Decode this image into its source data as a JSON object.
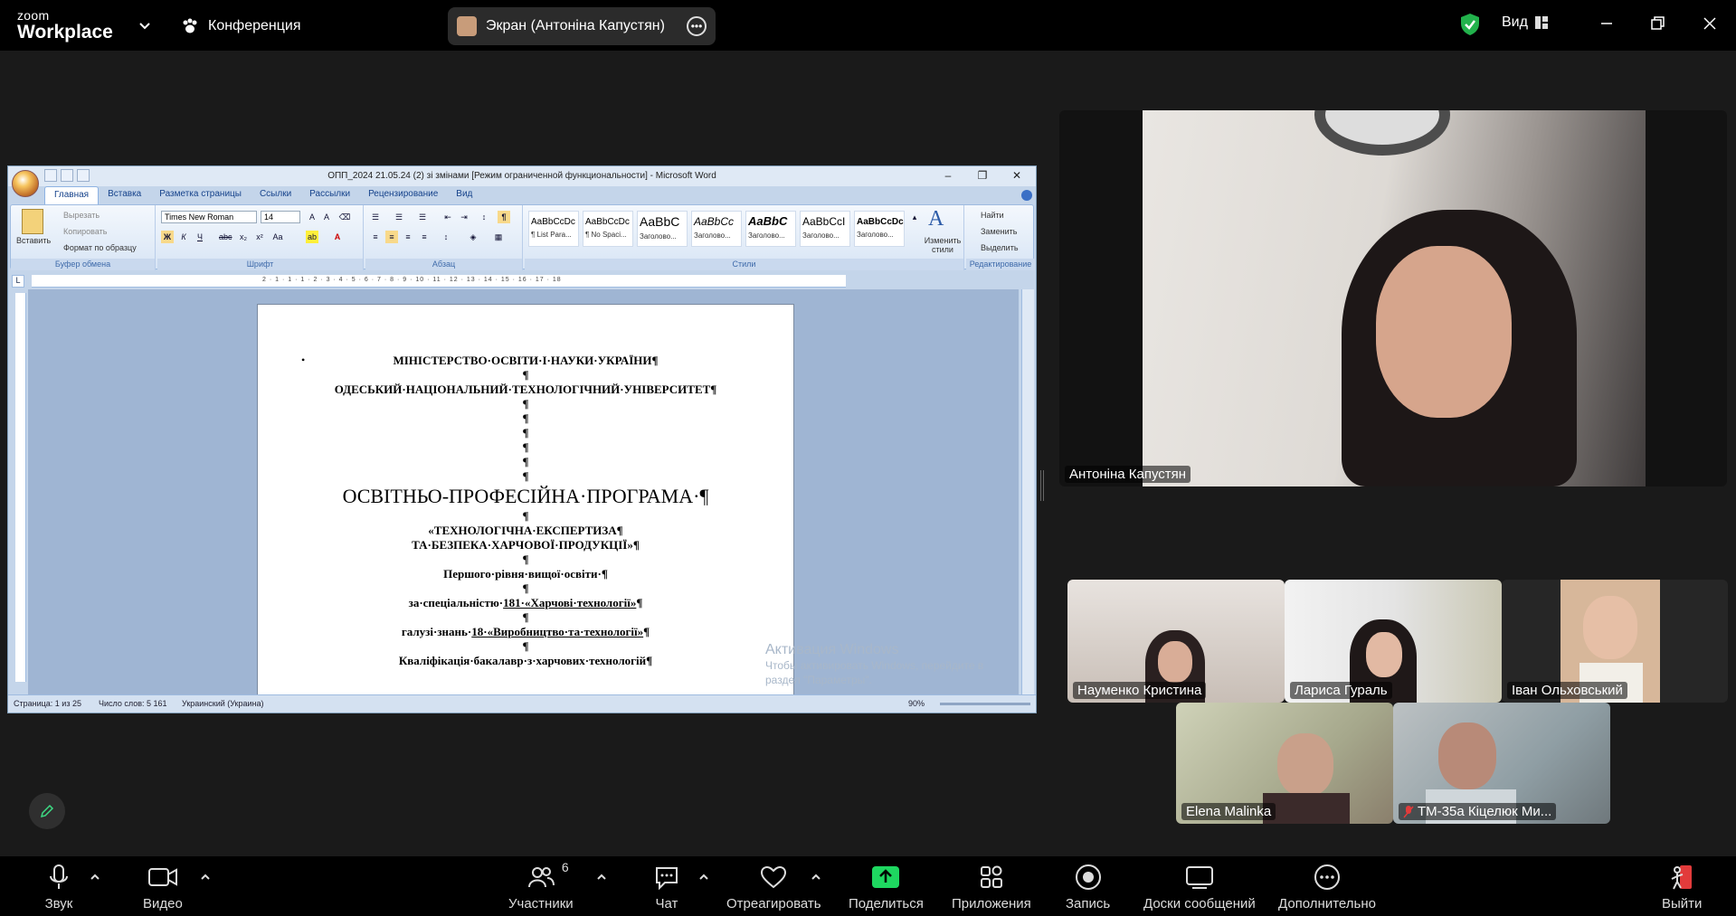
{
  "topbar": {
    "logo_line1": "zoom",
    "logo_line2": "Workplace",
    "conference_label": "Конференция",
    "share_label": "Экран (Антоніна Капустян)",
    "view_label": "Вид"
  },
  "word": {
    "title": "ОПП_2024 21.05.24 (2) зі змінами [Режим ограниченной функциональности] - Microsoft Word",
    "tabs": [
      "Главная",
      "Вставка",
      "Разметка страницы",
      "Ссылки",
      "Рассылки",
      "Рецензирование",
      "Вид"
    ],
    "clipboard": {
      "paste": "Вставить",
      "cut": "Вырезать",
      "copy": "Копировать",
      "format_painter": "Формат по образцу",
      "group": "Буфер обмена"
    },
    "font": {
      "name": "Times New Roman",
      "size": "14",
      "group": "Шрифт"
    },
    "paragraph_group": "Абзац",
    "styles": [
      {
        "sample": "AaBbCcDc",
        "name": "¶ List Para..."
      },
      {
        "sample": "AaBbCcDc",
        "name": "¶ No Spaci..."
      },
      {
        "sample": "AaBbC",
        "name": "Заголово..."
      },
      {
        "sample": "AaBbCc",
        "name": "Заголово..."
      },
      {
        "sample": "AaBbC",
        "name": "Заголово..."
      },
      {
        "sample": "AaBbCcI",
        "name": "Заголово..."
      },
      {
        "sample": "AaBbCcDc",
        "name": "Заголово..."
      }
    ],
    "change_styles": "Изменить стили",
    "styles_group": "Стили",
    "editing": {
      "find": "Найти",
      "replace": "Заменить",
      "select": "Выделить",
      "group": "Редактирование"
    },
    "doc_lines": {
      "l1": "МІНІСТЕРСТВО·ОСВІТИ·І·НАУКИ·УКРАЇНИ¶",
      "l2": "¶",
      "l3": "ОДЕСЬКИЙ·НАЦІОНАЛЬНИЙ·ТЕХНОЛОГІЧНИЙ·УНІВЕРСИТЕТ¶",
      "l4": "¶",
      "title": "ОСВІТНЬО-ПРОФЕСІЙНА·ПРОГРАМА·¶",
      "l5": "«ТЕХНОЛОГІЧНА·ЕКСПЕРТИЗА¶",
      "l6": "ТА·БЕЗПЕКА·ХАРЧОВОЇ·ПРОДУКЦІЇ»¶",
      "l7": "Першого·рівня·вищої·освіти·¶",
      "l8a": "за·спеціальністю·",
      "l8b": "181·«Харчові·технології»",
      "l8c": "¶",
      "l9a": "галузі·знань·",
      "l9b": "18·«Виробництво·та·технології»",
      "l9c": "¶",
      "l10": "Кваліфікація·бакалавр·з·харчових·технологій¶"
    },
    "status": {
      "page": "Страница: 1 из 25",
      "words": "Число слов: 5 161",
      "lang": "Украинский (Украина)",
      "zoom": "90%"
    },
    "ruler_marks": "2 · 1 · 1 · 1 · 2 · 3 · 4 · 5 · 6 · 7 · 8 · 9 · 10 · 11 · 12 · 13 · 14 · 15 · 16 · 17 · 18"
  },
  "activation": {
    "title": "Активация Windows",
    "sub": "Чтобы активировать Windows, перейдите в раздел \"Параметры\"."
  },
  "participants": {
    "main": "Антоніна Капустян",
    "p1": "Науменко Кристина",
    "p2": "Лариса Гураль",
    "p3": "Іван Ольховський",
    "p4": "Elena Malinka",
    "p5": "ТМ-35а Кіцелюк Ми..."
  },
  "toolbar": {
    "audio": "Звук",
    "video": "Видео",
    "participants": "Участники",
    "participants_count": "6",
    "chat": "Чат",
    "react": "Отреагировать",
    "share": "Поделиться",
    "apps": "Приложения",
    "record": "Запись",
    "whiteboards": "Доски сообщений",
    "more": "Дополнительно",
    "leave": "Выйти"
  },
  "colors": {
    "share_green": "#1ed760",
    "shield_green": "#22b24c",
    "leave_red": "#e23b3b"
  }
}
